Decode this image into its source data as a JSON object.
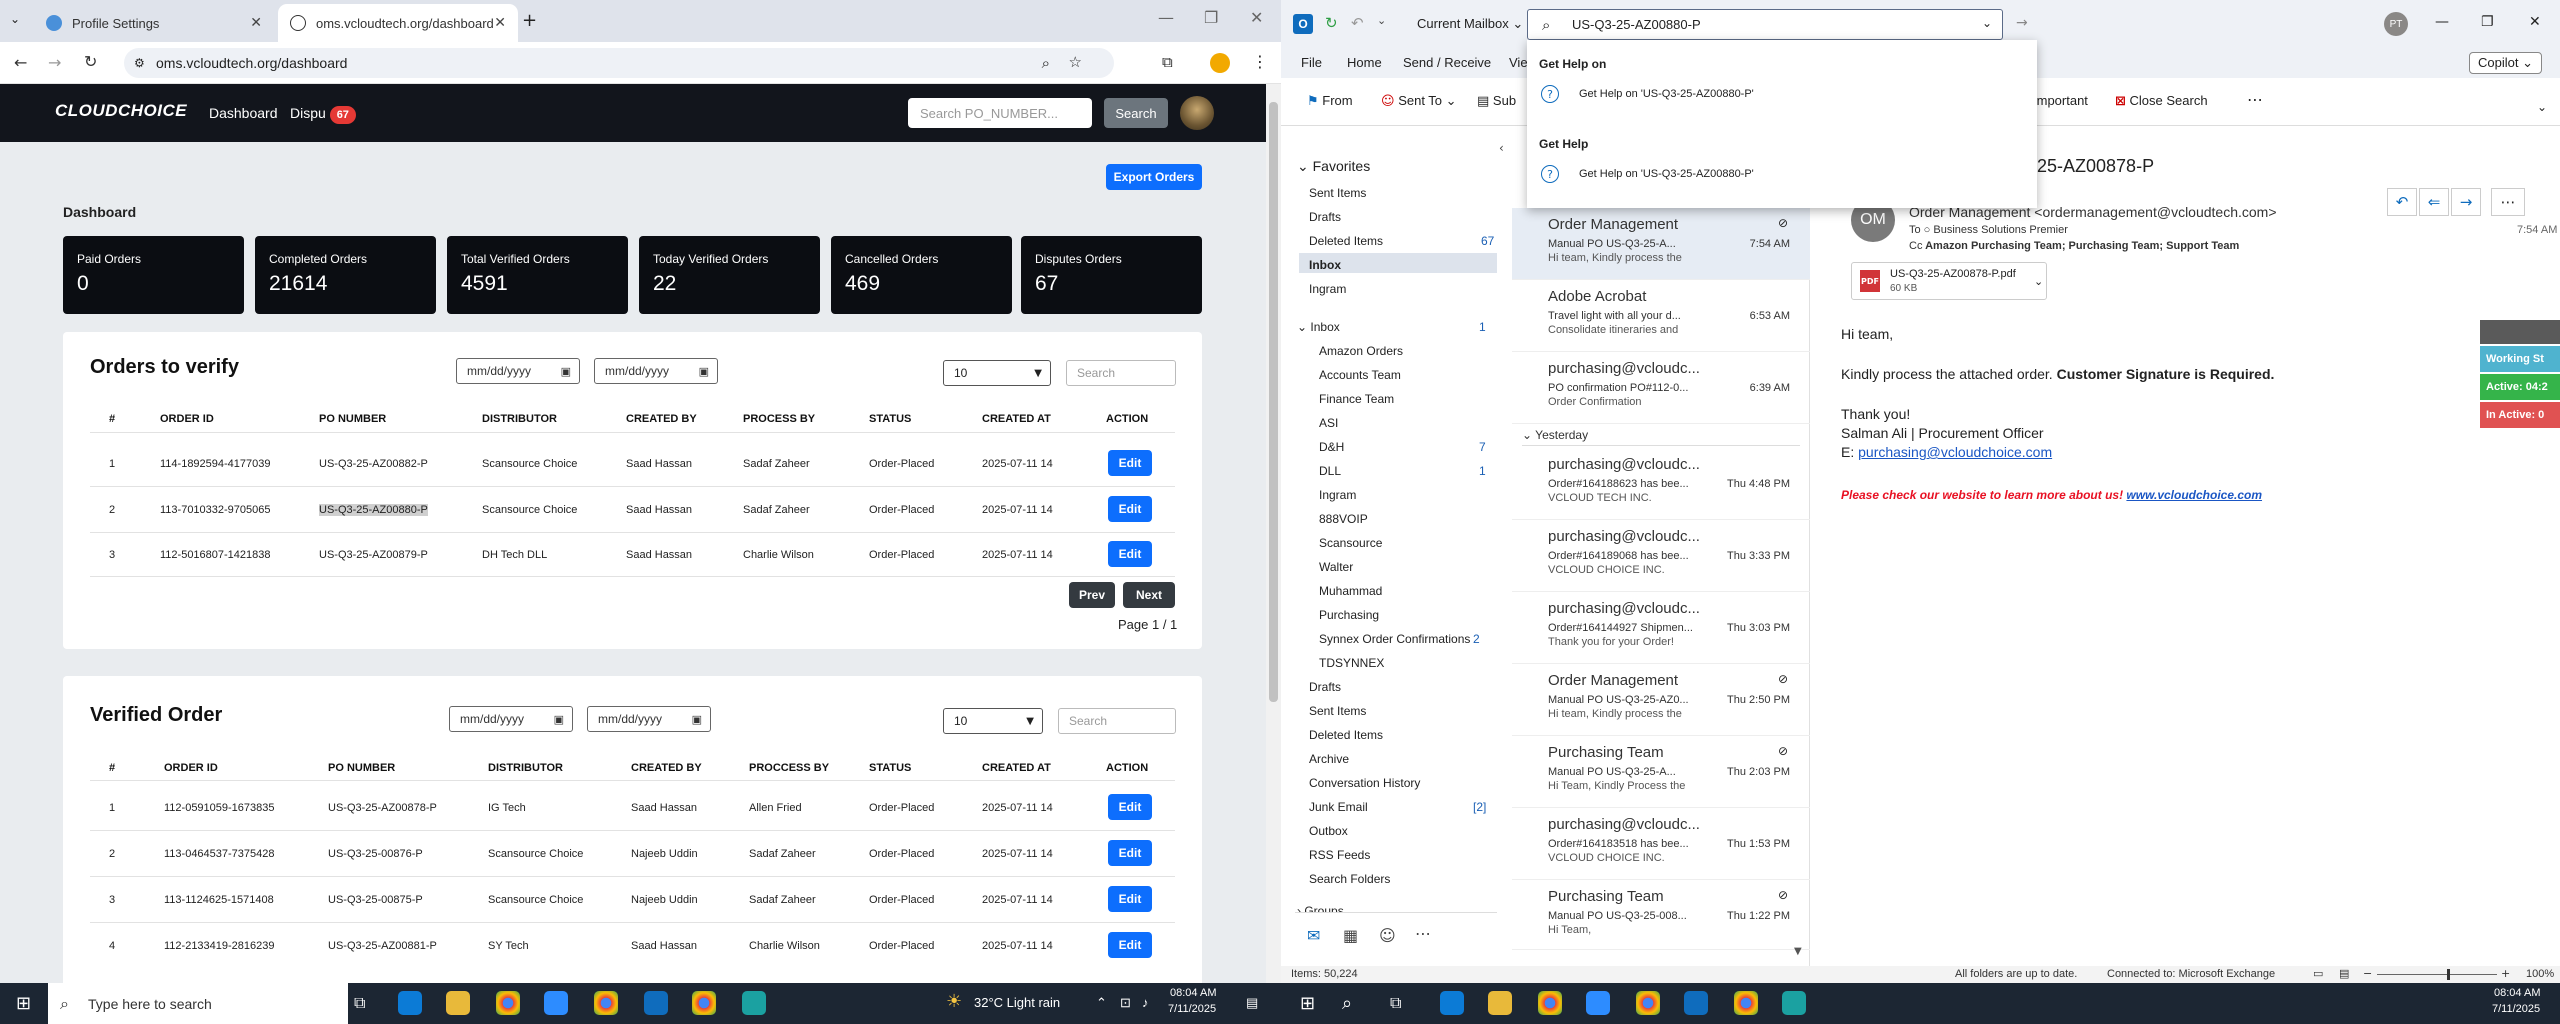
{
  "chrome": {
    "tab1_title": "Profile Settings",
    "tab2_title": "oms.vcloudtech.org/dashboard",
    "new_tab": "+",
    "url": "oms.vcloudtech.org/dashboard"
  },
  "app": {
    "logo": "CLOUDCHOICE",
    "nav": {
      "dashboard": "Dashboard",
      "disputes": "Dispu",
      "disputes_badge": "67"
    },
    "search_placeholder": "Search PO_NUMBER...",
    "search_button": "Search",
    "export_button": "Export Orders",
    "page_title": "Dashboard",
    "stats": [
      {
        "label": "Paid Orders",
        "value": "0"
      },
      {
        "label": "Completed Orders",
        "value": "21614"
      },
      {
        "label": "Total Verified Orders",
        "value": "4591"
      },
      {
        "label": "Today Verified Orders",
        "value": "22"
      },
      {
        "label": "Cancelled Orders",
        "value": "469"
      },
      {
        "label": "Disputes Orders",
        "value": "67"
      }
    ],
    "orders_to_verify": {
      "title": "Orders to verify",
      "date_placeholder": "mm/dd/yyyy",
      "page_size": "10",
      "search_placeholder": "Search",
      "headers": [
        "#",
        "ORDER ID",
        "PO NUMBER",
        "DISTRIBUTOR",
        "CREATED BY",
        "PROCESS BY",
        "STATUS",
        "CREATED AT",
        "ACTION"
      ],
      "rows": [
        {
          "n": "1",
          "order_id": "114-1892594-4177039",
          "po": "US-Q3-25-AZ00882-P",
          "distributor": "Scansource Choice",
          "created_by": "Saad Hassan",
          "process_by": "Sadaf Zaheer",
          "status": "Order-Placed",
          "created_at": "2025-07-11 14",
          "action": "Edit"
        },
        {
          "n": "2",
          "order_id": "113-7010332-9705065",
          "po": "US-Q3-25-AZ00880-P",
          "distributor": "Scansource Choice",
          "created_by": "Saad Hassan",
          "process_by": "Sadaf Zaheer",
          "status": "Order-Placed",
          "created_at": "2025-07-11 14",
          "action": "Edit"
        },
        {
          "n": "3",
          "order_id": "112-5016807-1421838",
          "po": "US-Q3-25-AZ00879-P",
          "distributor": "DH Tech DLL",
          "created_by": "Saad Hassan",
          "process_by": "Charlie Wilson",
          "status": "Order-Placed",
          "created_at": "2025-07-11 14",
          "action": "Edit"
        }
      ],
      "prev": "Prev",
      "next": "Next",
      "page_info": "Page 1 / 1"
    },
    "verified_order": {
      "title": "Verified Order",
      "date_placeholder": "mm/dd/yyyy",
      "page_size": "10",
      "search_placeholder": "Search",
      "headers": [
        "#",
        "ORDER ID",
        "PO NUMBER",
        "DISTRIBUTOR",
        "CREATED BY",
        "PROCCESS BY",
        "STATUS",
        "CREATED AT",
        "ACTION"
      ],
      "rows": [
        {
          "n": "1",
          "order_id": "112-0591059-1673835",
          "po": "US-Q3-25-AZ00878-P",
          "distributor": "IG Tech",
          "created_by": "Saad Hassan",
          "process_by": "Allen Fried",
          "status": "Order-Placed",
          "created_at": "2025-07-11 14",
          "action": "Edit"
        },
        {
          "n": "2",
          "order_id": "113-0464537-7375428",
          "po": "US-Q3-25-00876-P",
          "distributor": "Scansource Choice",
          "created_by": "Najeeb Uddin",
          "process_by": "Sadaf Zaheer",
          "status": "Order-Placed",
          "created_at": "2025-07-11 14",
          "action": "Edit"
        },
        {
          "n": "3",
          "order_id": "113-1124625-1571408",
          "po": "US-Q3-25-00875-P",
          "distributor": "Scansource Choice",
          "created_by": "Najeeb Uddin",
          "process_by": "Sadaf Zaheer",
          "status": "Order-Placed",
          "created_at": "2025-07-11 14",
          "action": "Edit"
        },
        {
          "n": "4",
          "order_id": "112-2133419-2816239",
          "po": "US-Q3-25-AZ00881-P",
          "distributor": "SY Tech",
          "created_by": "Saad Hassan",
          "process_by": "Charlie Wilson",
          "status": "Order-Placed",
          "created_at": "2025-07-11 14",
          "action": "Edit"
        }
      ]
    }
  },
  "outlook": {
    "mailbox_scope": "Current Mailbox",
    "search_value": "US-Q3-25-AZ00880-P",
    "user_initials": "PT",
    "copilot": "Copilot",
    "menu": [
      "File",
      "Home",
      "Send / Receive",
      "Vie"
    ],
    "ribbon": {
      "from": "From",
      "sent_to": "Sent To",
      "sub": "Sub",
      "important": "Important",
      "close_search": "Close Search"
    },
    "dropdown": {
      "section1": "Get Help on",
      "item1": "Get Help on 'US-Q3-25-AZ00880-P'",
      "section2": "Get Help",
      "item2": "Get Help on 'US-Q3-25-AZ00880-P'"
    },
    "folders": {
      "favorites": "Favorites",
      "fav_items": [
        {
          "name": "Sent Items",
          "count": ""
        },
        {
          "name": "Drafts",
          "count": ""
        },
        {
          "name": "Deleted Items",
          "count": "67"
        },
        {
          "name": "Inbox",
          "count": ""
        },
        {
          "name": "Ingram",
          "count": ""
        }
      ],
      "inbox": "Inbox",
      "inbox_count": "1",
      "inbox_items": [
        {
          "name": "Amazon Orders",
          "count": ""
        },
        {
          "name": "Accounts Team",
          "count": ""
        },
        {
          "name": "Finance Team",
          "count": ""
        },
        {
          "name": "ASI",
          "count": ""
        },
        {
          "name": "D&H",
          "count": "7"
        },
        {
          "name": "DLL",
          "count": "1"
        },
        {
          "name": "Ingram",
          "count": ""
        },
        {
          "name": "888VOIP",
          "count": ""
        },
        {
          "name": "Scansource",
          "count": ""
        },
        {
          "name": "Walter",
          "count": ""
        },
        {
          "name": "Muhammad",
          "count": ""
        },
        {
          "name": "Purchasing",
          "count": ""
        },
        {
          "name": "Synnex Order Confirmations",
          "count": "2"
        },
        {
          "name": "TDSYNNEX",
          "count": ""
        }
      ],
      "root_items": [
        {
          "name": "Drafts",
          "count": ""
        },
        {
          "name": "Sent Items",
          "count": ""
        },
        {
          "name": "Deleted Items",
          "count": ""
        },
        {
          "name": "Archive",
          "count": ""
        },
        {
          "name": "Conversation History",
          "count": ""
        },
        {
          "name": "Junk Email",
          "count": "[2]"
        },
        {
          "name": "Outbox",
          "count": ""
        },
        {
          "name": "RSS Feeds",
          "count": ""
        },
        {
          "name": "Search Folders",
          "count": ""
        },
        {
          "name": "Groups",
          "count": ""
        }
      ]
    },
    "messages_today": [
      {
        "from": "Order Management",
        "sub": "Manual PO    US-Q3-25-A...",
        "prev": "Hi team,  Kindly process the",
        "time": "7:54 AM",
        "clip": true
      },
      {
        "from": "Adobe Acrobat",
        "sub": "Travel light with all your d...",
        "prev": "Consolidate itineraries and",
        "time": "6:53 AM",
        "clip": false
      },
      {
        "from": "purchasing@vcloudc...",
        "sub": "PO confirmation PO#112-0...",
        "prev": "Order Confirmation",
        "time": "6:39 AM",
        "clip": false
      }
    ],
    "yesterday": "Yesterday",
    "messages_yesterday": [
      {
        "from": "purchasing@vcloudc...",
        "sub": "Order#164188623 has bee...",
        "prev": "VCLOUD TECH INC.",
        "time": "Thu 4:48 PM",
        "clip": false
      },
      {
        "from": "purchasing@vcloudc...",
        "sub": "Order#164189068 has bee...",
        "prev": "VCLOUD CHOICE INC.",
        "time": "Thu 3:33 PM",
        "clip": false
      },
      {
        "from": "purchasing@vcloudc...",
        "sub": "Order#164144927 Shipmen...",
        "prev": "Thank you for your Order!",
        "time": "Thu 3:03 PM",
        "clip": false
      },
      {
        "from": "Order Management",
        "sub": "Manual PO    US-Q3-25-AZ0...",
        "prev": "Hi team,  Kindly process the",
        "time": "Thu 2:50 PM",
        "clip": true
      },
      {
        "from": "Purchasing Team",
        "sub": "Manual PO    US-Q3-25-A...",
        "prev": "Hi Team,   Kindly Process the",
        "time": "Thu 2:03 PM",
        "clip": true
      },
      {
        "from": "purchasing@vcloudc...",
        "sub": "Order#164183518 has bee...",
        "prev": "VCLOUD CHOICE INC.",
        "time": "Thu 1:53 PM",
        "clip": false
      },
      {
        "from": "Purchasing Team",
        "sub": "Manual PO    US-Q3-25-008...",
        "prev": "Hi Team,",
        "time": "Thu 1:22 PM",
        "clip": true
      }
    ],
    "reading": {
      "subject": "25-AZ00878-P",
      "avatar": "OM",
      "sender": "Order Management <ordermanagement@vcloudtech.com>",
      "to_label": "To",
      "to": "Business Solutions Premier",
      "cc_label": "Cc",
      "cc": "Amazon Purchasing Team;  Purchasing Team;  Support Team",
      "time": "7:54 AM",
      "attachment_name": "US-Q3-25-AZ00878-P.pdf",
      "attachment_size": "60 KB",
      "greeting": "Hi team,",
      "body1": "Kindly process the attached order. ",
      "body1_bold": "Customer Signature is Required.",
      "thanks": "Thank you!",
      "sig_name": "Salman Ali  | Procurement Officer",
      "sig_email_label": "E: ",
      "sig_email": "purchasing@vcloudchoice.com",
      "promo": "Please check our website to learn more about us! ",
      "promo_link": "www.vcloudchoice.com",
      "side_tags": [
        "Working St",
        "Active: 04:2",
        "In Active: 0"
      ]
    },
    "status": {
      "items": "Items: 50,224",
      "sync": "All folders are up to date.",
      "conn": "Connected to: Microsoft Exchange",
      "zoom": "100%"
    }
  },
  "taskbar": {
    "search": "Type here to search",
    "weather": "32°C  Light rain",
    "time1": "08:04 AM",
    "date1": "7/11/2025",
    "time2": "08:04 AM",
    "date2": "7/11/2025"
  }
}
